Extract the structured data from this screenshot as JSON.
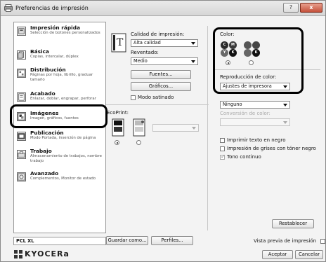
{
  "window": {
    "title": "Preferencias de impresión",
    "help_label": "?",
    "close_label": "x"
  },
  "sidebar": {
    "items": [
      {
        "title": "Impresión rápida",
        "desc": "Selección de botones personalizados",
        "icon": "quick-print-icon"
      },
      {
        "title": "Básica",
        "desc": "Copias, intercalar, dúplex",
        "icon": "basic-icon"
      },
      {
        "title": "Distribución",
        "desc": "Páginas por hoja, librillo, graduar tamaño",
        "icon": "layout-icon"
      },
      {
        "title": "Acabado",
        "desc": "Enlazar, doblar, engrapar, perforar",
        "icon": "finishing-icon"
      },
      {
        "title": "Imágenes",
        "desc": "Imagen, gráficos, fuentes",
        "icon": "imaging-icon"
      },
      {
        "title": "Publicación",
        "desc": "Modo Portada, inserción de página",
        "icon": "publishing-icon"
      },
      {
        "title": "Trabajo",
        "desc": "Almacenamiento de trabajos, nombre trabajo",
        "icon": "job-icon"
      },
      {
        "title": "Avanzado",
        "desc": "Complementos, Monitor de estado",
        "icon": "advanced-icon"
      }
    ]
  },
  "quality": {
    "label": "Calidad de impresión:",
    "value": "Alta calidad",
    "halftone_label": "Reventado:",
    "halftone_value": "Medio",
    "fonts_button": "Fuentes...",
    "graphics_button": "Gráficos...",
    "satin_label": "Modo satinado"
  },
  "color": {
    "label": "Color:",
    "color_circles": [
      "C",
      "M",
      "Y",
      "K"
    ],
    "mono_circles": [
      "K"
    ],
    "reproduction_label": "Reproducción de color:",
    "reproduction_value": "Ajustes de impresora",
    "none_value": "Ninguno",
    "conversion_label": "Conversión de color:",
    "print_black_label": "Imprimir texto en negro",
    "gray_toner_label": "Impresión de grises con tóner negro",
    "continuous_tone_label": "Tono continuo",
    "reset_button": "Restablecer"
  },
  "ecoprint": {
    "label": "EcoPrint:"
  },
  "footer": {
    "pcl_label": "PCL XL",
    "save_as_button": "Guardar como...",
    "profiles_button": "Perfiles...",
    "preview_label": "Vista previa de impresión",
    "accept_button": "Aceptar",
    "cancel_button": "Cancelar",
    "logo_text": "KYOCERa"
  },
  "colors": {
    "cyan": "#1a1a1a",
    "magenta": "#3a3a3a",
    "yellow": "#6a6a6a",
    "black": "#111111",
    "highlight": "#000000"
  }
}
